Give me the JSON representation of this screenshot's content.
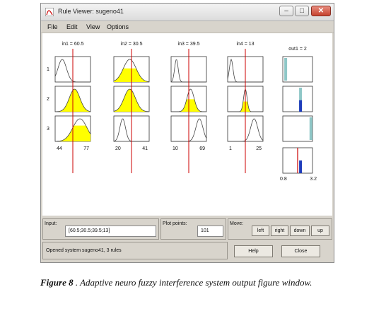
{
  "window": {
    "title": "Rule Viewer: sugeno41",
    "menu": [
      "File",
      "Edit",
      "View",
      "Options"
    ]
  },
  "viewer": {
    "inputs": [
      {
        "header": "in1 = 60.5",
        "range_min": "44",
        "range_max": "77",
        "cursor": 0.5
      },
      {
        "header": "in2 = 30.5",
        "range_min": "20",
        "range_max": "41",
        "cursor": 0.5
      },
      {
        "header": "in3 = 39.5",
        "range_min": "10",
        "range_max": "69",
        "cursor": 0.5
      },
      {
        "header": "in4 = 13",
        "range_min": "1",
        "range_max": "25",
        "cursor": 0.5
      }
    ],
    "output": {
      "header": "out1 = 2",
      "range_min": "0.8",
      "range_max": "3.2",
      "value": 2
    },
    "rules": [
      {
        "label": "1",
        "fills": [
          0.0,
          0.6,
          0.0,
          0.0
        ],
        "output_level": 0.0
      },
      {
        "label": "2",
        "fills": [
          1.0,
          1.0,
          0.55,
          0.45
        ],
        "output_level": 0.45
      },
      {
        "label": "3",
        "fills": [
          0.7,
          0.0,
          0.0,
          0.0
        ],
        "output_level": 0.0
      }
    ]
  },
  "controls": {
    "input_label": "Input:",
    "input_value": "[60.5;30.5;39.5;13]",
    "plot_points_label": "Plot points:",
    "plot_points_value": "101",
    "move_label": "Move:",
    "move_buttons": [
      "left",
      "right",
      "down",
      "up"
    ],
    "help_label": "Help",
    "close_label": "Close",
    "status": "Opened system sugeno41, 3 rules"
  },
  "caption": {
    "figure_label": "Figure 8",
    "text": ". Adaptive neuro fuzzy interference system output figure window."
  },
  "colors": {
    "accent": "#ffff00",
    "cursor": "#cc0000",
    "output_bar": "#8fc7c7",
    "output_fill": "#1f3dbb"
  }
}
